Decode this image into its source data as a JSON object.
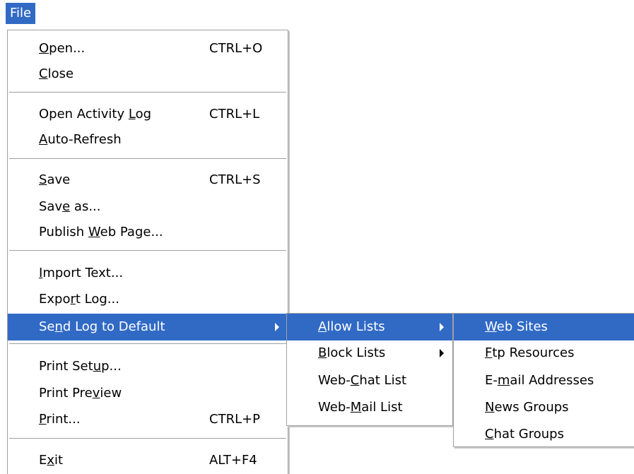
{
  "menubar": {
    "file": "File"
  },
  "file_menu": {
    "items": [
      {
        "pre": "",
        "u": "O",
        "post": "pen...",
        "shortcut": "CTRL+O"
      },
      {
        "pre": "",
        "u": "C",
        "post": "lose",
        "shortcut": ""
      },
      {
        "pre": "Open Activity ",
        "u": "L",
        "post": "og",
        "shortcut": "CTRL+L"
      },
      {
        "pre": "",
        "u": "A",
        "post": "uto-Refresh",
        "shortcut": ""
      },
      {
        "pre": "",
        "u": "S",
        "post": "ave",
        "shortcut": "CTRL+S"
      },
      {
        "pre": "Sav",
        "u": "e",
        "post": " as...",
        "shortcut": ""
      },
      {
        "pre": "Publish ",
        "u": "W",
        "post": "eb Page...",
        "shortcut": ""
      },
      {
        "pre": "",
        "u": "I",
        "post": "mport Text...",
        "shortcut": ""
      },
      {
        "pre": "Expo",
        "u": "r",
        "post": "t Log...",
        "shortcut": ""
      },
      {
        "pre": "Se",
        "u": "n",
        "post": "d Log to Default",
        "shortcut": ""
      },
      {
        "pre": "Print Set",
        "u": "u",
        "post": "p...",
        "shortcut": ""
      },
      {
        "pre": "Print Pre",
        "u": "v",
        "post": "iew",
        "shortcut": ""
      },
      {
        "pre": "",
        "u": "P",
        "post": "rint...",
        "shortcut": "CTRL+P"
      },
      {
        "pre": "E",
        "u": "x",
        "post": "it",
        "shortcut": "ALT+F4"
      }
    ]
  },
  "allow_submenu": {
    "items": [
      {
        "pre": "",
        "u": "A",
        "post": "llow Lists"
      },
      {
        "pre": "",
        "u": "B",
        "post": "lock Lists"
      },
      {
        "pre": "Web-",
        "u": "C",
        "post": "hat List"
      },
      {
        "pre": "Web-",
        "u": "M",
        "post": "ail List"
      }
    ]
  },
  "web_submenu": {
    "items": [
      {
        "pre": "",
        "u": "W",
        "post": "eb Sites"
      },
      {
        "pre": "",
        "u": "F",
        "post": "tp Resources"
      },
      {
        "pre": "E-",
        "u": "m",
        "post": "ail Addresses"
      },
      {
        "pre": "",
        "u": "N",
        "post": "ews Groups"
      },
      {
        "pre": "",
        "u": "C",
        "post": "hat Groups"
      }
    ]
  },
  "colors": {
    "highlight": "#316ac5",
    "separator": "#a0a0a0"
  }
}
